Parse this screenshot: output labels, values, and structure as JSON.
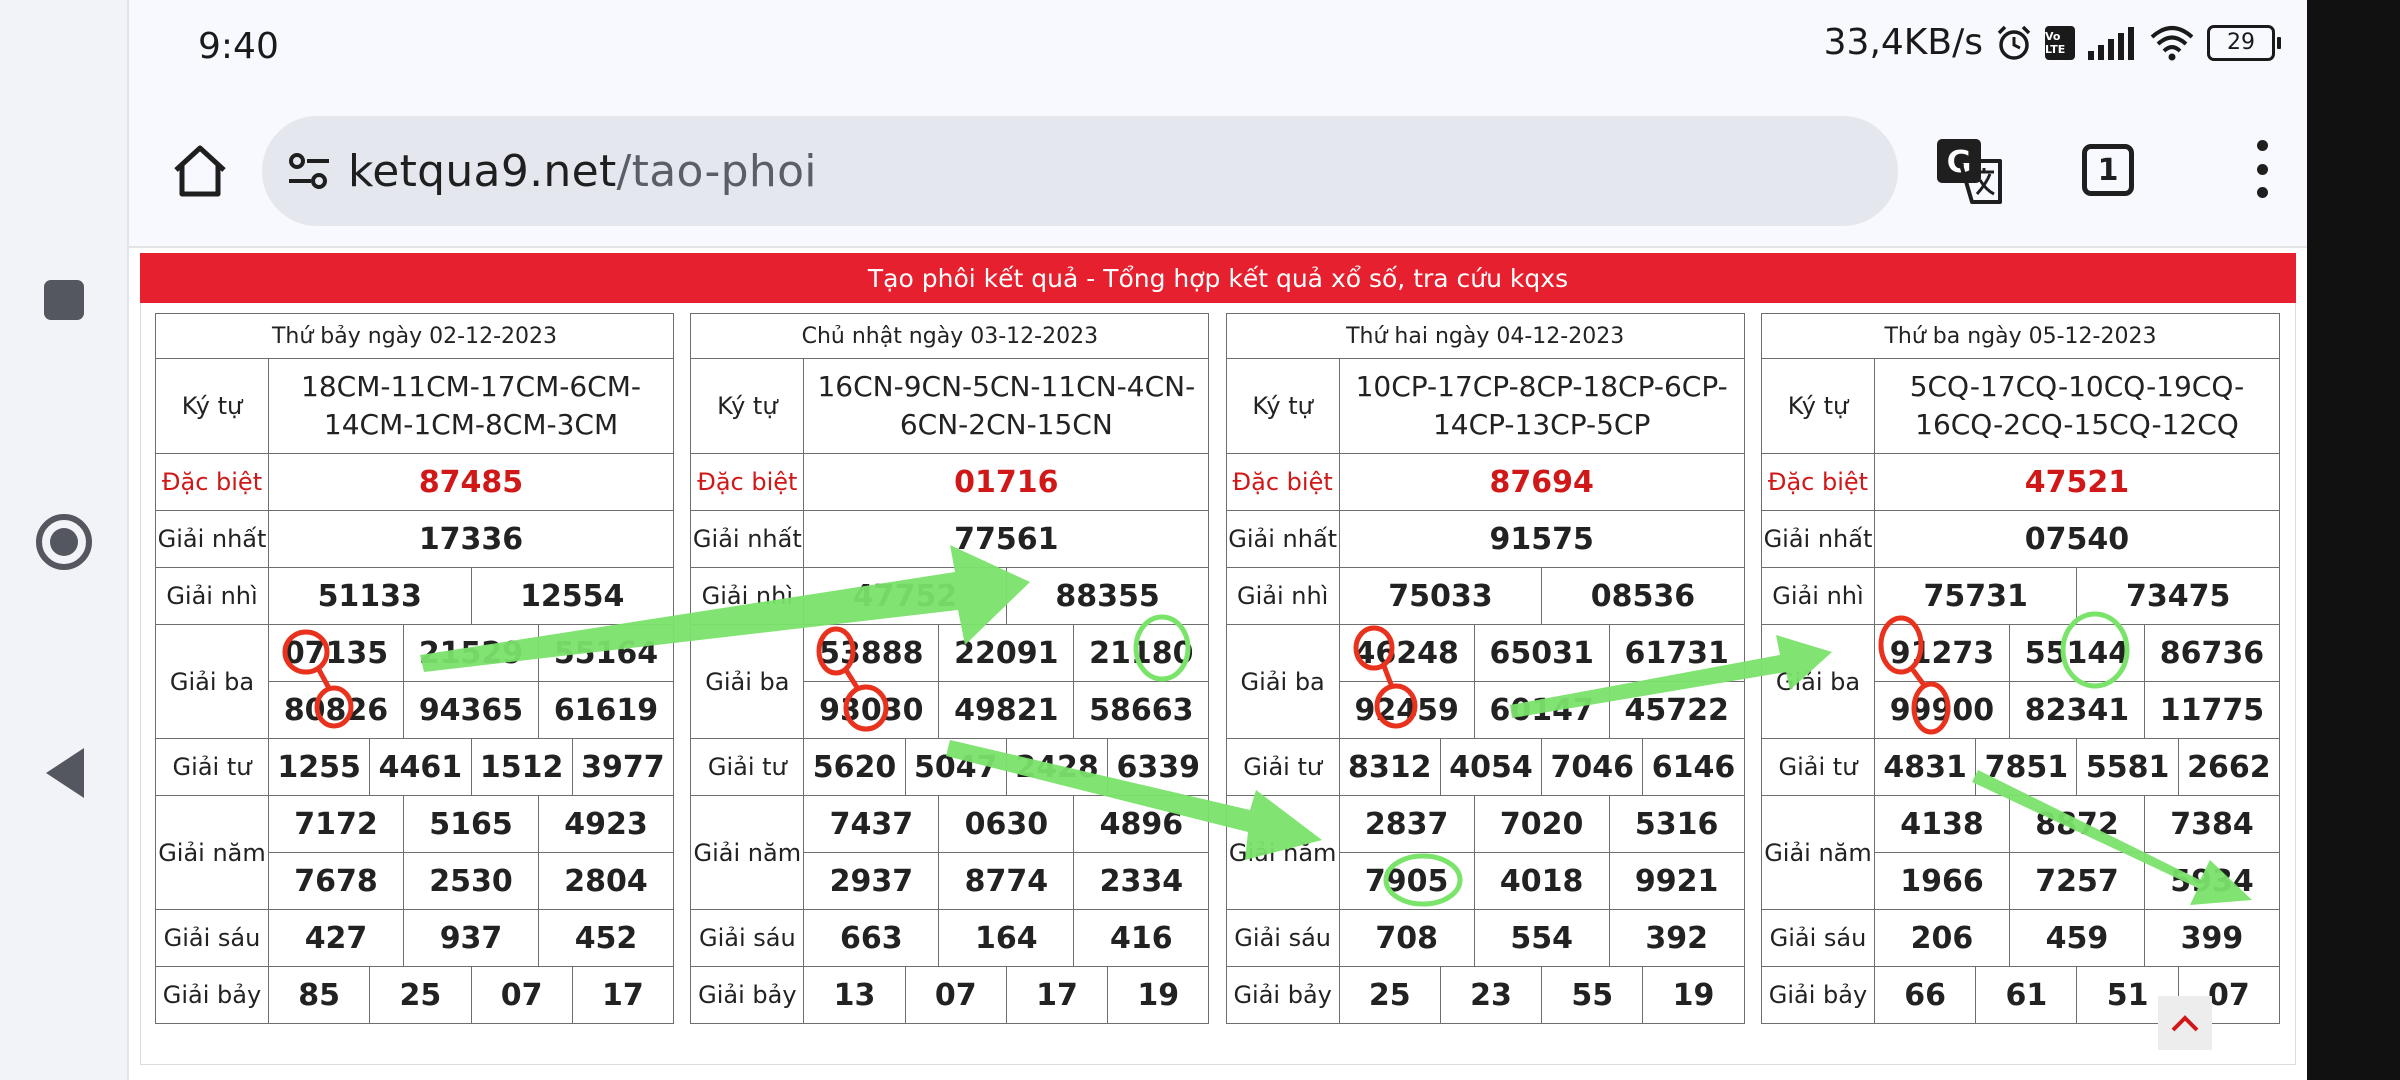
{
  "status": {
    "time": "9:40",
    "net_speed": "33,4KB/s",
    "volte": "Vo LTE",
    "battery": "29"
  },
  "browser": {
    "url_domain": "ketqua9.net",
    "url_path": "/tao-phoi",
    "tabs_count": "1"
  },
  "page": {
    "banner": "Tạo phôi kết quả - Tổng hợp kết quả xổ số, tra cứu kqxs"
  },
  "labels": {
    "kytu": "Ký tự",
    "db": "Đặc biệt",
    "g1": "Giải nhất",
    "g2": "Giải nhì",
    "g3": "Giải ba",
    "g4": "Giải tư",
    "g5": "Giải năm",
    "g6": "Giải sáu",
    "g7": "Giải bảy"
  },
  "tables": [
    {
      "date": "Thứ bảy ngày 02-12-2023",
      "kytu": "18CM-11CM-17CM-6CM-14CM-1CM-8CM-3CM",
      "db": "87485",
      "g1": "17336",
      "g2": [
        "51133",
        "12554"
      ],
      "g3": [
        "07135",
        "21529",
        "55164",
        "80826",
        "94365",
        "61619"
      ],
      "g4": [
        "1255",
        "4461",
        "1512",
        "3977"
      ],
      "g5": [
        "7172",
        "5165",
        "4923",
        "7678",
        "2530",
        "2804"
      ],
      "g6": [
        "427",
        "937",
        "452"
      ],
      "g7": [
        "85",
        "25",
        "07",
        "17"
      ]
    },
    {
      "date": "Chủ nhật ngày 03-12-2023",
      "kytu": "16CN-9CN-5CN-11CN-4CN-6CN-2CN-15CN",
      "db": "01716",
      "g1": "77561",
      "g2": [
        "47752",
        "88355"
      ],
      "g3": [
        "53888",
        "22091",
        "21180",
        "93030",
        "49821",
        "58663"
      ],
      "g4": [
        "5620",
        "5047",
        "2428",
        "6339"
      ],
      "g5": [
        "7437",
        "0630",
        "4896",
        "2937",
        "8774",
        "2334"
      ],
      "g6": [
        "663",
        "164",
        "416"
      ],
      "g7": [
        "13",
        "07",
        "17",
        "19"
      ]
    },
    {
      "date": "Thứ hai ngày 04-12-2023",
      "kytu": "10CP-17CP-8CP-18CP-6CP-14CP-13CP-5CP",
      "db": "87694",
      "g1": "91575",
      "g2": [
        "75033",
        "08536"
      ],
      "g3": [
        "46248",
        "65031",
        "61731",
        "92459",
        "60147",
        "45722"
      ],
      "g4": [
        "8312",
        "4054",
        "7046",
        "6146"
      ],
      "g5": [
        "2837",
        "7020",
        "5316",
        "7905",
        "4018",
        "9921"
      ],
      "g6": [
        "708",
        "554",
        "392"
      ],
      "g7": [
        "25",
        "23",
        "55",
        "19"
      ]
    },
    {
      "date": "Thứ ba ngày 05-12-2023",
      "kytu": "5CQ-17CQ-10CQ-19CQ-16CQ-2CQ-15CQ-12CQ",
      "db": "47521",
      "g1": "07540",
      "g2": [
        "75731",
        "73475"
      ],
      "g3": [
        "91273",
        "55144",
        "86736",
        "99900",
        "82341",
        "11775"
      ],
      "g4": [
        "4831",
        "7851",
        "5581",
        "2662"
      ],
      "g5": [
        "4138",
        "8872",
        "7384",
        "1966",
        "7257",
        "5934"
      ],
      "g6": [
        "206",
        "459",
        "399"
      ],
      "g7": [
        "66",
        "61",
        "51",
        "07"
      ]
    }
  ],
  "colors": {
    "banner": "#e6202e",
    "special": "#d01818",
    "arrow": "#7ae36a",
    "circle_red": "#e8321e",
    "circle_green": "#7ae36a"
  }
}
